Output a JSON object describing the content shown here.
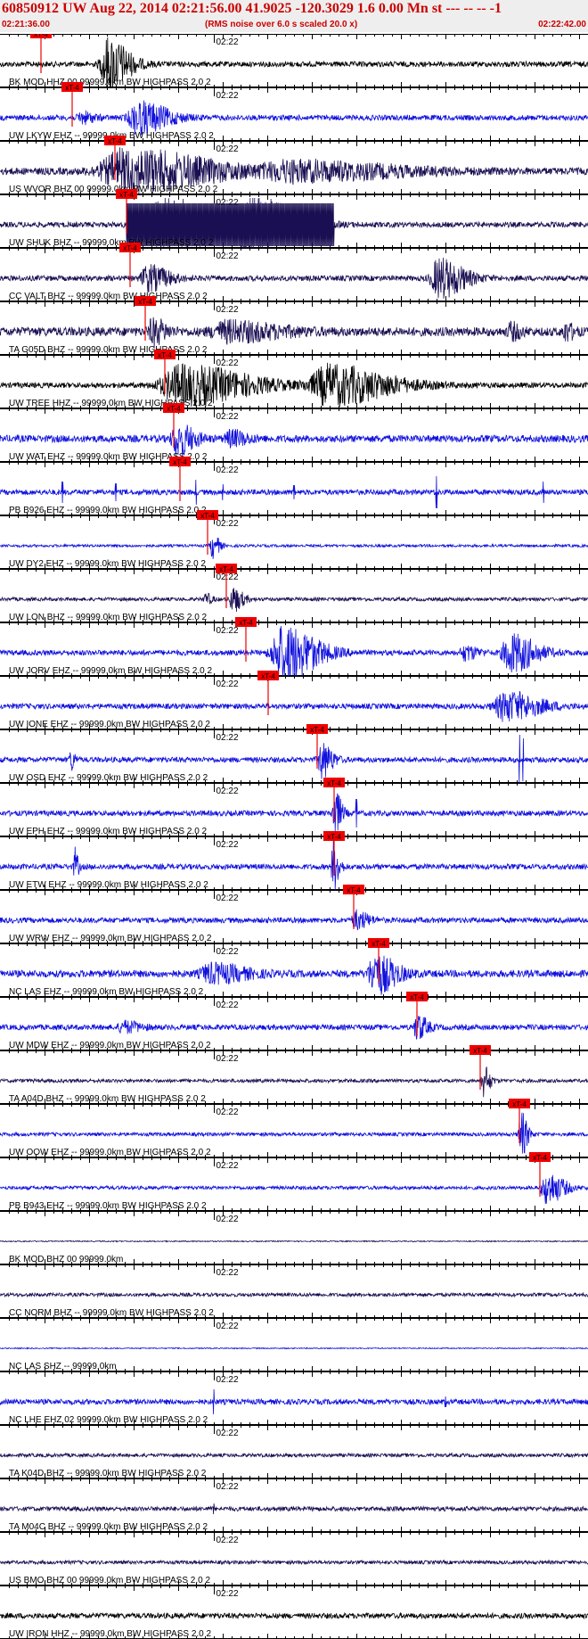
{
  "header": {
    "title": "60850912 UW Aug 22, 2014 02:21:56.00   41.9025 -120.3029  1.6 0.00 Mn st --- -- --   -1",
    "start_time": "02:21:36.00",
    "end_time": "02:22:42.00",
    "subtitle": "(RMS noise over 6.0 s scaled 20.0 x)"
  },
  "chart_data": {
    "type": "line",
    "title": "60850912 UW Aug 22, 2014 02:21:56.00   41.9025 -120.3029  1.6 0.00 Mn st --- -- --   -1",
    "x_unit": "seconds after 02:21:36.00",
    "xlim": [
      0,
      66
    ],
    "mid_tick_label": "02:22",
    "mid_tick_time": 24,
    "pick_label": "xT-4",
    "colors": {
      "navy": "#1a0f52",
      "blue": "#1111dd",
      "black": "#000000",
      "pick": "#ee0000"
    },
    "traces": [
      {
        "label": "BK MOD HHZ 00 99999.0km BW  HIGHPASS  2.0  2",
        "color": "black",
        "pick": 4.6,
        "amp": 3,
        "bursts": [
          [
            13.5,
            2.5,
            30
          ]
        ]
      },
      {
        "label": "UW LKYW EHZ -- 99999.0km BW  HIGHPASS  2.0  2",
        "color": "blue",
        "pick": 8.1,
        "amp": 3,
        "bursts": [
          [
            17.5,
            3.5,
            18
          ],
          [
            10,
            1.5,
            6
          ]
        ]
      },
      {
        "label": "US WVOR BHZ 00 99999.0km BW  HIGHPASS  2.0  2",
        "color": "navy",
        "pick": 12.9,
        "amp": 4,
        "bursts": [
          [
            20,
            10,
            24
          ],
          [
            40,
            12,
            10
          ]
        ]
      },
      {
        "label": "UW SHUK BHZ -- 99999.0km BW  HIGHPASS  2.0  2",
        "color": "navy",
        "pick": 14.2,
        "amp": 3,
        "bursts": [
          [
            23,
            8,
            28
          ],
          [
            31,
            5,
            28
          ]
        ],
        "clip": 37.5
      },
      {
        "label": "CC VALT BHZ -- 99999.0km BW  HIGHPASS  2.0  2",
        "color": "navy",
        "pick": 14.6,
        "amp": 3,
        "bursts": [
          [
            18,
            2.5,
            14
          ],
          [
            51,
            3,
            22
          ]
        ]
      },
      {
        "label": "TA G05D BHZ -- 99999.0km BW  HIGHPASS  2.0  2",
        "color": "navy",
        "pick": 16.3,
        "amp": 5,
        "bursts": [
          [
            18,
            1.5,
            14
          ],
          [
            29,
            6,
            10
          ],
          [
            58,
            1.2,
            8
          ],
          [
            64,
            1,
            9
          ]
        ]
      },
      {
        "label": "UW TREE HHZ -- 99999.0km BW  HIGHPASS  2.0  2",
        "color": "black",
        "pick": 18.5,
        "amp": 3,
        "bursts": [
          [
            25,
            8,
            22
          ],
          [
            41,
            7,
            22
          ]
        ]
      },
      {
        "label": "UW WAT EHZ -- 99999.0km BW  HIGHPASS  2.0  2",
        "color": "blue",
        "pick": 19.5,
        "amp": 4,
        "bursts": [
          [
            21,
            2,
            18
          ],
          [
            27,
            2,
            8
          ]
        ]
      },
      {
        "label": "PB B926 EHZ -- 99999.0km BW  HIGHPASS  2.0  2",
        "color": "blue",
        "pick": 20.2,
        "amp": 3,
        "spikes": [
          [
            7,
            12
          ],
          [
            13,
            10
          ],
          [
            22,
            14
          ],
          [
            25,
            9
          ],
          [
            33,
            8
          ],
          [
            49,
            18
          ],
          [
            61,
            12
          ]
        ]
      },
      {
        "label": "UW DY2 EHZ -- 99999.0km BW  HIGHPASS  2.0  2",
        "color": "blue",
        "pick": 23.3,
        "amp": 1.5,
        "bursts": [
          [
            24.3,
            0.8,
            14
          ]
        ]
      },
      {
        "label": "UW LON BHZ -- 99999.0km BW  HIGHPASS  2.0  2",
        "color": "navy",
        "pick": 25.4,
        "amp": 2,
        "bursts": [
          [
            26.8,
            1.2,
            14
          ],
          [
            23.5,
            0.8,
            6
          ]
        ]
      },
      {
        "label": "UW JORV EHZ -- 99999.0km BW  HIGHPASS  2.0  2",
        "color": "blue",
        "pick": 27.6,
        "amp": 3,
        "bursts": [
          [
            34,
            4,
            32
          ],
          [
            59,
            3,
            22
          ],
          [
            53,
            1.5,
            8
          ]
        ]
      },
      {
        "label": "UW IONE EHZ -- 99999.0km BW  HIGHPASS  2.0  2",
        "color": "blue",
        "pick": 30.1,
        "amp": 3,
        "bursts": [
          [
            59,
            4,
            16
          ]
        ]
      },
      {
        "label": "UW OSD EHZ -- 99999.0km BW  HIGHPASS  2.0  2",
        "color": "blue",
        "pick": 35.6,
        "amp": 3,
        "bursts": [
          [
            36.8,
            1.3,
            20
          ],
          [
            8.2,
            0.5,
            12
          ]
        ],
        "spikes": [
          [
            58.3,
            28
          ],
          [
            58.7,
            24
          ]
        ]
      },
      {
        "label": "UW EPH EHZ -- 99999.0km BW  HIGHPASS  2.0  2",
        "color": "blue",
        "pick": 37.5,
        "amp": 3,
        "bursts": [
          [
            38,
            0.8,
            26
          ]
        ],
        "spikes": [
          [
            40,
            16
          ]
        ]
      },
      {
        "label": "UW ETW EHZ -- 99999.0km BW  HIGHPASS  2.0  2",
        "color": "blue",
        "pick": 37.5,
        "amp": 3,
        "bursts": [
          [
            37.8,
            0.7,
            28
          ],
          [
            8.6,
            0.4,
            20
          ]
        ]
      },
      {
        "label": "UW WRW EHZ -- 99999.0km BW  HIGHPASS  2.0  2",
        "color": "blue",
        "pick": 39.7,
        "amp": 3,
        "bursts": [
          [
            40.8,
            1.5,
            10
          ]
        ]
      },
      {
        "label": "NC LAS EHZ -- 99999.0km BW  HIGHPASS  2.0  2",
        "color": "blue",
        "pick": 42.5,
        "amp": 4,
        "bursts": [
          [
            43.5,
            2.5,
            22
          ],
          [
            26,
            4,
            10
          ]
        ]
      },
      {
        "label": "UW MDW EHZ -- 99999.0km BW  HIGHPASS  2.0  2",
        "color": "blue",
        "pick": 46.8,
        "amp": 3,
        "bursts": [
          [
            47.5,
            1.2,
            14
          ],
          [
            15,
            2,
            6
          ]
        ]
      },
      {
        "label": "TA A04D BHZ -- 99999.0km BW  HIGHPASS  2.0  2",
        "color": "navy",
        "pick": 53.9,
        "amp": 2,
        "bursts": [
          [
            54.7,
            0.8,
            18
          ]
        ]
      },
      {
        "label": "UW OOW EHZ -- 99999.0km BW  HIGHPASS  2.0  2",
        "color": "blue",
        "pick": 58.3,
        "amp": 2,
        "bursts": [
          [
            58.9,
            0.8,
            26
          ]
        ]
      },
      {
        "label": "PB B943 EHZ -- 99999.0km BW  HIGHPASS  2.0  2",
        "color": "blue",
        "pick": 60.6,
        "amp": 2,
        "bursts": [
          [
            62.5,
            2,
            18
          ]
        ]
      },
      {
        "label": "BK MOD BHZ 00 99999.0km",
        "color": "navy",
        "amp": 0.6
      },
      {
        "label": "CC NORM BHZ -- 99999.0km BW  HIGHPASS  2.0  2",
        "color": "navy",
        "amp": 2
      },
      {
        "label": "NC LAS SHZ -- 99999.0km",
        "color": "blue",
        "amp": 0.6
      },
      {
        "label": "NC LHE EHZ 02 99999.0km BW  HIGHPASS  2.0  2",
        "color": "blue",
        "amp": 3,
        "spikes": [
          [
            24,
            14
          ],
          [
            50,
            6
          ]
        ]
      },
      {
        "label": "TA K04D BHZ -- 99999.0km BW  HIGHPASS  2.0  2",
        "color": "navy",
        "amp": 2
      },
      {
        "label": "TA M04C BHZ -- 99999.0km BW  HIGHPASS  2.0  2",
        "color": "navy",
        "amp": 2.5,
        "spikes": [
          [
            24,
            6
          ]
        ]
      },
      {
        "label": "US BMO BHZ 00 99999.0km BW  HIGHPASS  2.0  2",
        "color": "navy",
        "amp": 2
      },
      {
        "label": "UW IRON HHZ -- 99999.0km BW  HIGHPASS  2.0  2",
        "color": "black",
        "amp": 3
      }
    ]
  }
}
